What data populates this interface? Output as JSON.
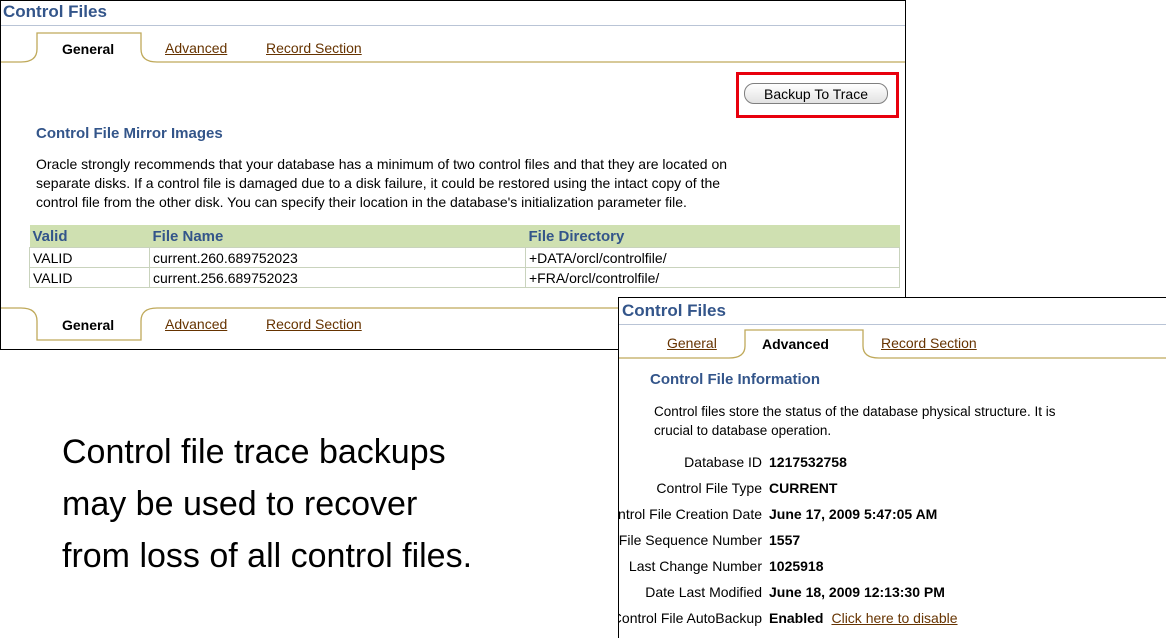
{
  "panel_general": {
    "title": "Control Files",
    "tabs": [
      "General",
      "Advanced",
      "Record Section"
    ],
    "backup_button": "Backup To Trace",
    "section_title": "Control File Mirror Images",
    "paragraph": [
      "Oracle strongly recommends that your database has a minimum of two control files and that they are located on",
      "separate disks. If a control file is damaged due to a disk failure, it could be restored using the intact copy of the",
      "control file from the other disk. You can specify their location in the database's initialization parameter file."
    ],
    "table": {
      "headers": [
        "Valid",
        "File Name",
        "File Directory"
      ],
      "rows": [
        [
          "VALID",
          "current.260.689752023",
          "+DATA/orcl/controlfile/"
        ],
        [
          "VALID",
          "current.256.689752023",
          "+FRA/orcl/controlfile/"
        ]
      ]
    },
    "bottom_tabs": [
      "General",
      "Advanced",
      "Record Section"
    ]
  },
  "panel_advanced": {
    "title": "Control Files",
    "tabs": [
      "General",
      "Advanced",
      "Record Section"
    ],
    "section_title": "Control File Information",
    "paragraph": [
      "Control files store the status of the database physical structure. It is",
      "crucial to database operation."
    ],
    "fields": [
      {
        "label": "Database ID",
        "value": "1217532758"
      },
      {
        "label": "Control File Type",
        "value": "CURRENT"
      },
      {
        "label": "Control File Creation Date",
        "value": "June 17, 2009 5:47:05 AM"
      },
      {
        "label": "Control File Sequence Number",
        "value": "1557"
      },
      {
        "label": "Last Change Number",
        "value": "1025918"
      },
      {
        "label": "Date Last Modified",
        "value": "June 18, 2009 12:13:30 PM"
      },
      {
        "label": "Control File AutoBackup",
        "value": "Enabled",
        "link": "Click here to disable"
      }
    ]
  },
  "caption": [
    "Control file trace backups",
    "may be used to recover",
    "from loss of all control files."
  ],
  "colors": {
    "title_blue": "#33558a",
    "header_green": "#cfe0b1",
    "link_brown": "#663300",
    "highlight_red": "#e8000d"
  }
}
